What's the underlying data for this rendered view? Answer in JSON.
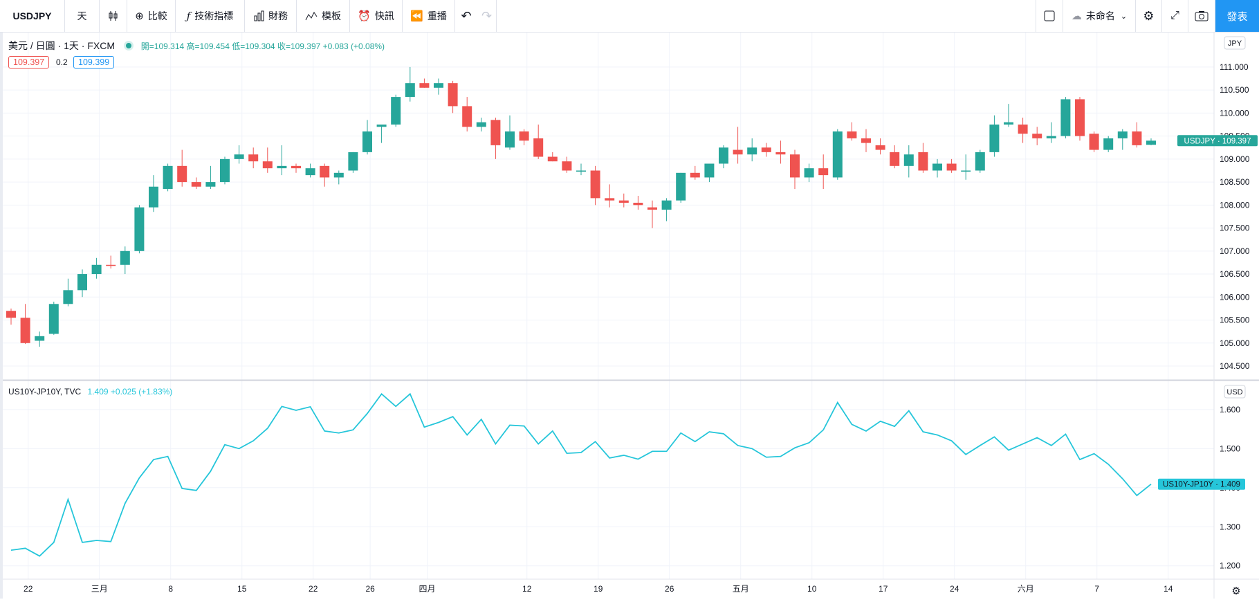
{
  "toolbar": {
    "symbol": "USDJPY",
    "interval": "天",
    "compare": "比較",
    "indicators": "技術指標",
    "financials": "財務",
    "templates": "模板",
    "alert": "快訊",
    "replay": "重播",
    "layout_name": "未命名",
    "publish": "發表"
  },
  "main_legend": {
    "title": "美元 / 日圓 · 1天 · FXCM",
    "ohlc": "開=109.314 高=109.454 低=109.304 收=109.397 +0.083 (+0.08%)",
    "bid": "109.397",
    "spread": "0.2",
    "ask": "109.399"
  },
  "sub_legend": {
    "title": "US10Y-JP10Y, TVC",
    "value": "1.409 +0.025 (+1.83%)"
  },
  "colors": {
    "up": "#26a69a",
    "down": "#ef5350",
    "line": "#26c6da",
    "accent": "#2196f3"
  },
  "chart_data": [
    {
      "type": "candlestick",
      "series_name": "USDJPY",
      "currency": "JPY",
      "last_label": "USDJPY · 109.397",
      "ylim": [
        104.35,
        111.6
      ],
      "y_ticks": [
        "104.500",
        "105.000",
        "105.500",
        "106.000",
        "106.500",
        "107.000",
        "107.500",
        "108.000",
        "108.500",
        "109.000",
        "109.500",
        "110.000",
        "110.500",
        "111.000"
      ],
      "x_ticks": [
        "22",
        "三月",
        "8",
        "15",
        "22",
        "26",
        "四月",
        "12",
        "19",
        "26",
        "五月",
        "10",
        "17",
        "24",
        "六月",
        "7",
        "14"
      ],
      "x_tick_index": [
        1.2,
        6.2,
        11.2,
        16.2,
        21.2,
        25.2,
        29.2,
        36.2,
        41.2,
        46.2,
        51.2,
        56.2,
        61.2,
        66.2,
        71.2,
        76.2,
        81.2
      ],
      "candles": [
        [
          105.7,
          105.75,
          105.4,
          105.55
        ],
        [
          105.55,
          105.85,
          104.98,
          105.0
        ],
        [
          105.05,
          105.25,
          104.92,
          105.15
        ],
        [
          105.2,
          105.9,
          105.18,
          105.85
        ],
        [
          105.85,
          106.4,
          105.8,
          106.15
        ],
        [
          106.15,
          106.6,
          106.0,
          106.5
        ],
        [
          106.5,
          106.85,
          106.4,
          106.7
        ],
        [
          106.7,
          106.9,
          106.62,
          106.68
        ],
        [
          106.7,
          107.1,
          106.5,
          107.0
        ],
        [
          107.0,
          108.0,
          106.95,
          107.95
        ],
        [
          107.95,
          108.65,
          107.85,
          108.4
        ],
        [
          108.35,
          108.9,
          108.3,
          108.85
        ],
        [
          108.85,
          109.2,
          108.4,
          108.5
        ],
        [
          108.5,
          108.6,
          108.35,
          108.4
        ],
        [
          108.4,
          108.85,
          108.35,
          108.5
        ],
        [
          108.5,
          109.05,
          108.45,
          109.0
        ],
        [
          109.0,
          109.3,
          108.9,
          109.1
        ],
        [
          109.1,
          109.25,
          108.8,
          108.95
        ],
        [
          108.95,
          109.25,
          108.7,
          108.8
        ],
        [
          108.8,
          109.3,
          108.65,
          108.85
        ],
        [
          108.85,
          108.9,
          108.7,
          108.8
        ],
        [
          108.65,
          108.9,
          108.6,
          108.8
        ],
        [
          108.85,
          108.9,
          108.4,
          108.6
        ],
        [
          108.6,
          108.75,
          108.45,
          108.7
        ],
        [
          108.75,
          109.15,
          108.7,
          109.15
        ],
        [
          109.15,
          109.85,
          109.1,
          109.6
        ],
        [
          109.7,
          109.75,
          109.35,
          109.75
        ],
        [
          109.75,
          110.4,
          109.7,
          110.35
        ],
        [
          110.35,
          111.0,
          110.25,
          110.65
        ],
        [
          110.65,
          110.75,
          110.55,
          110.55
        ],
        [
          110.55,
          110.75,
          110.4,
          110.65
        ],
        [
          110.65,
          110.7,
          110.0,
          110.15
        ],
        [
          110.15,
          110.35,
          109.6,
          109.7
        ],
        [
          109.7,
          109.9,
          109.6,
          109.8
        ],
        [
          109.85,
          109.9,
          109.0,
          109.3
        ],
        [
          109.25,
          109.95,
          109.2,
          109.6
        ],
        [
          109.6,
          109.65,
          109.3,
          109.4
        ],
        [
          109.45,
          109.75,
          109.0,
          109.05
        ],
        [
          109.05,
          109.15,
          108.95,
          108.95
        ],
        [
          108.95,
          109.05,
          108.7,
          108.75
        ],
        [
          108.75,
          108.9,
          108.65,
          108.75
        ],
        [
          108.75,
          108.85,
          108.0,
          108.15
        ],
        [
          108.15,
          108.45,
          107.95,
          108.1
        ],
        [
          108.1,
          108.25,
          107.95,
          108.05
        ],
        [
          108.05,
          108.2,
          107.9,
          108.0
        ],
        [
          107.95,
          108.1,
          107.5,
          107.9
        ],
        [
          107.9,
          108.15,
          107.65,
          108.1
        ],
        [
          108.1,
          108.7,
          108.05,
          108.7
        ],
        [
          108.7,
          108.85,
          108.55,
          108.6
        ],
        [
          108.6,
          108.9,
          108.5,
          108.9
        ],
        [
          108.9,
          109.3,
          108.8,
          109.25
        ],
        [
          109.2,
          109.7,
          108.9,
          109.1
        ],
        [
          109.1,
          109.45,
          108.95,
          109.25
        ],
        [
          109.25,
          109.35,
          109.05,
          109.15
        ],
        [
          109.15,
          109.4,
          108.9,
          109.1
        ],
        [
          109.1,
          109.2,
          108.35,
          108.6
        ],
        [
          108.6,
          108.9,
          108.5,
          108.8
        ],
        [
          108.8,
          109.1,
          108.35,
          108.65
        ],
        [
          108.6,
          109.65,
          108.55,
          109.6
        ],
        [
          109.6,
          109.8,
          109.4,
          109.45
        ],
        [
          109.45,
          109.65,
          109.15,
          109.35
        ],
        [
          109.3,
          109.45,
          109.1,
          109.2
        ],
        [
          109.15,
          109.3,
          108.8,
          108.85
        ],
        [
          108.85,
          109.3,
          108.6,
          109.1
        ],
        [
          109.15,
          109.35,
          108.7,
          108.75
        ],
        [
          108.75,
          109.0,
          108.6,
          108.9
        ],
        [
          108.9,
          109.0,
          108.7,
          108.75
        ],
        [
          108.75,
          109.1,
          108.55,
          108.75
        ],
        [
          108.75,
          109.2,
          108.7,
          109.15
        ],
        [
          109.15,
          109.95,
          109.05,
          109.75
        ],
        [
          109.75,
          110.2,
          109.7,
          109.8
        ],
        [
          109.75,
          109.9,
          109.35,
          109.55
        ],
        [
          109.55,
          109.7,
          109.3,
          109.45
        ],
        [
          109.45,
          109.8,
          109.35,
          109.5
        ],
        [
          109.5,
          110.35,
          109.45,
          110.3
        ],
        [
          110.3,
          110.35,
          109.4,
          109.5
        ],
        [
          109.55,
          109.6,
          109.15,
          109.2
        ],
        [
          109.2,
          109.5,
          109.15,
          109.45
        ],
        [
          109.45,
          109.65,
          109.2,
          109.6
        ],
        [
          109.6,
          109.8,
          109.25,
          109.3
        ],
        [
          109.31,
          109.45,
          109.3,
          109.4
        ]
      ]
    },
    {
      "type": "line",
      "series_name": "US10Y-JP10Y",
      "currency": "USD",
      "last_label": "US10Y-JP10Y · 1.409",
      "ylim": [
        1.18,
        1.66
      ],
      "y_ticks": [
        "1.200",
        "1.300",
        "1.400",
        "1.500",
        "1.600"
      ],
      "values": [
        1.24,
        1.245,
        1.225,
        1.26,
        1.37,
        1.26,
        1.265,
        1.262,
        1.36,
        1.425,
        1.472,
        1.48,
        1.398,
        1.393,
        1.442,
        1.51,
        1.5,
        1.52,
        1.552,
        1.608,
        1.598,
        1.607,
        1.545,
        1.54,
        1.548,
        1.59,
        1.64,
        1.608,
        1.64,
        1.555,
        1.567,
        1.582,
        1.535,
        1.575,
        1.512,
        1.56,
        1.558,
        1.512,
        1.545,
        1.488,
        1.49,
        1.518,
        1.476,
        1.483,
        1.473,
        1.493,
        1.493,
        1.54,
        1.518,
        1.543,
        1.538,
        1.508,
        1.5,
        1.478,
        1.48,
        1.502,
        1.515,
        1.548,
        1.618,
        1.562,
        1.545,
        1.57,
        1.557,
        1.597,
        1.543,
        1.535,
        1.52,
        1.485,
        1.508,
        1.53,
        1.496,
        1.512,
        1.528,
        1.508,
        1.537,
        1.472,
        1.487,
        1.46,
        1.423,
        1.38,
        1.409
      ]
    }
  ]
}
